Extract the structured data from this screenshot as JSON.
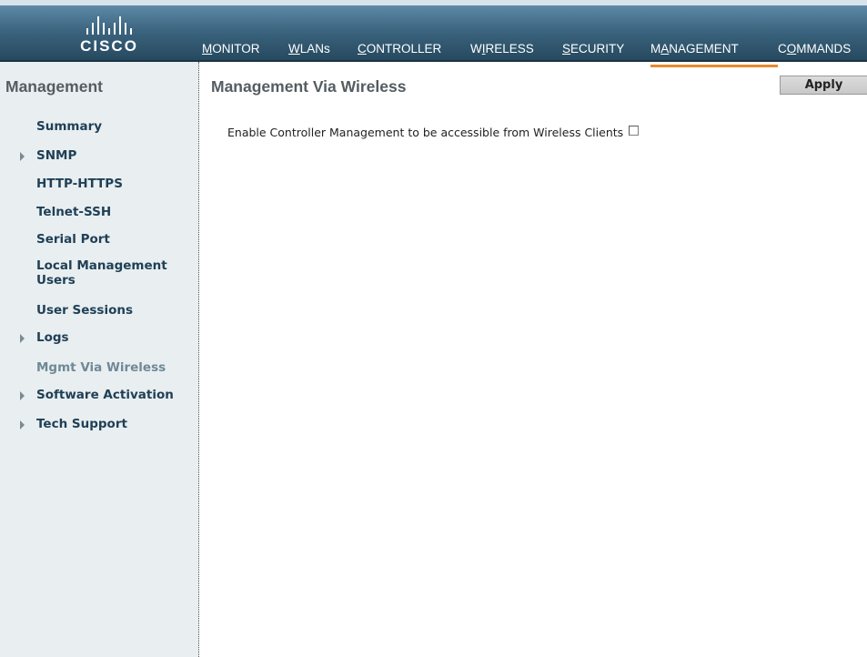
{
  "brand": {
    "logo_text": "CISCO"
  },
  "nav": {
    "items": [
      {
        "pre": "",
        "key": "M",
        "post": "ONITOR"
      },
      {
        "pre": "",
        "key": "W",
        "post": "LANs"
      },
      {
        "pre": "",
        "key": "C",
        "post": "ONTROLLER"
      },
      {
        "pre": "W",
        "key": "I",
        "post": "RELESS"
      },
      {
        "pre": "",
        "key": "S",
        "post": "ECURITY"
      },
      {
        "pre": "M",
        "key": "A",
        "post": "NAGEMENT"
      },
      {
        "pre": "C",
        "key": "O",
        "post": "MMANDS"
      }
    ],
    "active_index": 5
  },
  "sidebar": {
    "title": "Management",
    "items": [
      {
        "label": "Summary",
        "expandable": false,
        "selected": false
      },
      {
        "label": "SNMP",
        "expandable": true,
        "selected": false
      },
      {
        "label": "HTTP-HTTPS",
        "expandable": false,
        "selected": false
      },
      {
        "label": "Telnet-SSH",
        "expandable": false,
        "selected": false
      },
      {
        "label": "Serial Port",
        "expandable": false,
        "selected": false
      },
      {
        "label": "Local Management Users",
        "expandable": false,
        "selected": false
      },
      {
        "label": "User Sessions",
        "expandable": false,
        "selected": false
      },
      {
        "label": "Logs",
        "expandable": true,
        "selected": false
      },
      {
        "label": "Mgmt Via Wireless",
        "expandable": false,
        "selected": true
      },
      {
        "label": "Software Activation",
        "expandable": true,
        "selected": false
      },
      {
        "label": "Tech Support",
        "expandable": true,
        "selected": false
      }
    ]
  },
  "main": {
    "title": "Management Via Wireless",
    "apply_label": "Apply",
    "option_label": "Enable Controller Management to be accessible from Wireless Clients",
    "option_checked": false
  },
  "colors": {
    "accent": "#e88a2e",
    "header": "#3c6580",
    "sidebar_bg": "#e9eef0",
    "link": "#1f4057",
    "selected_link": "#6f8996"
  }
}
